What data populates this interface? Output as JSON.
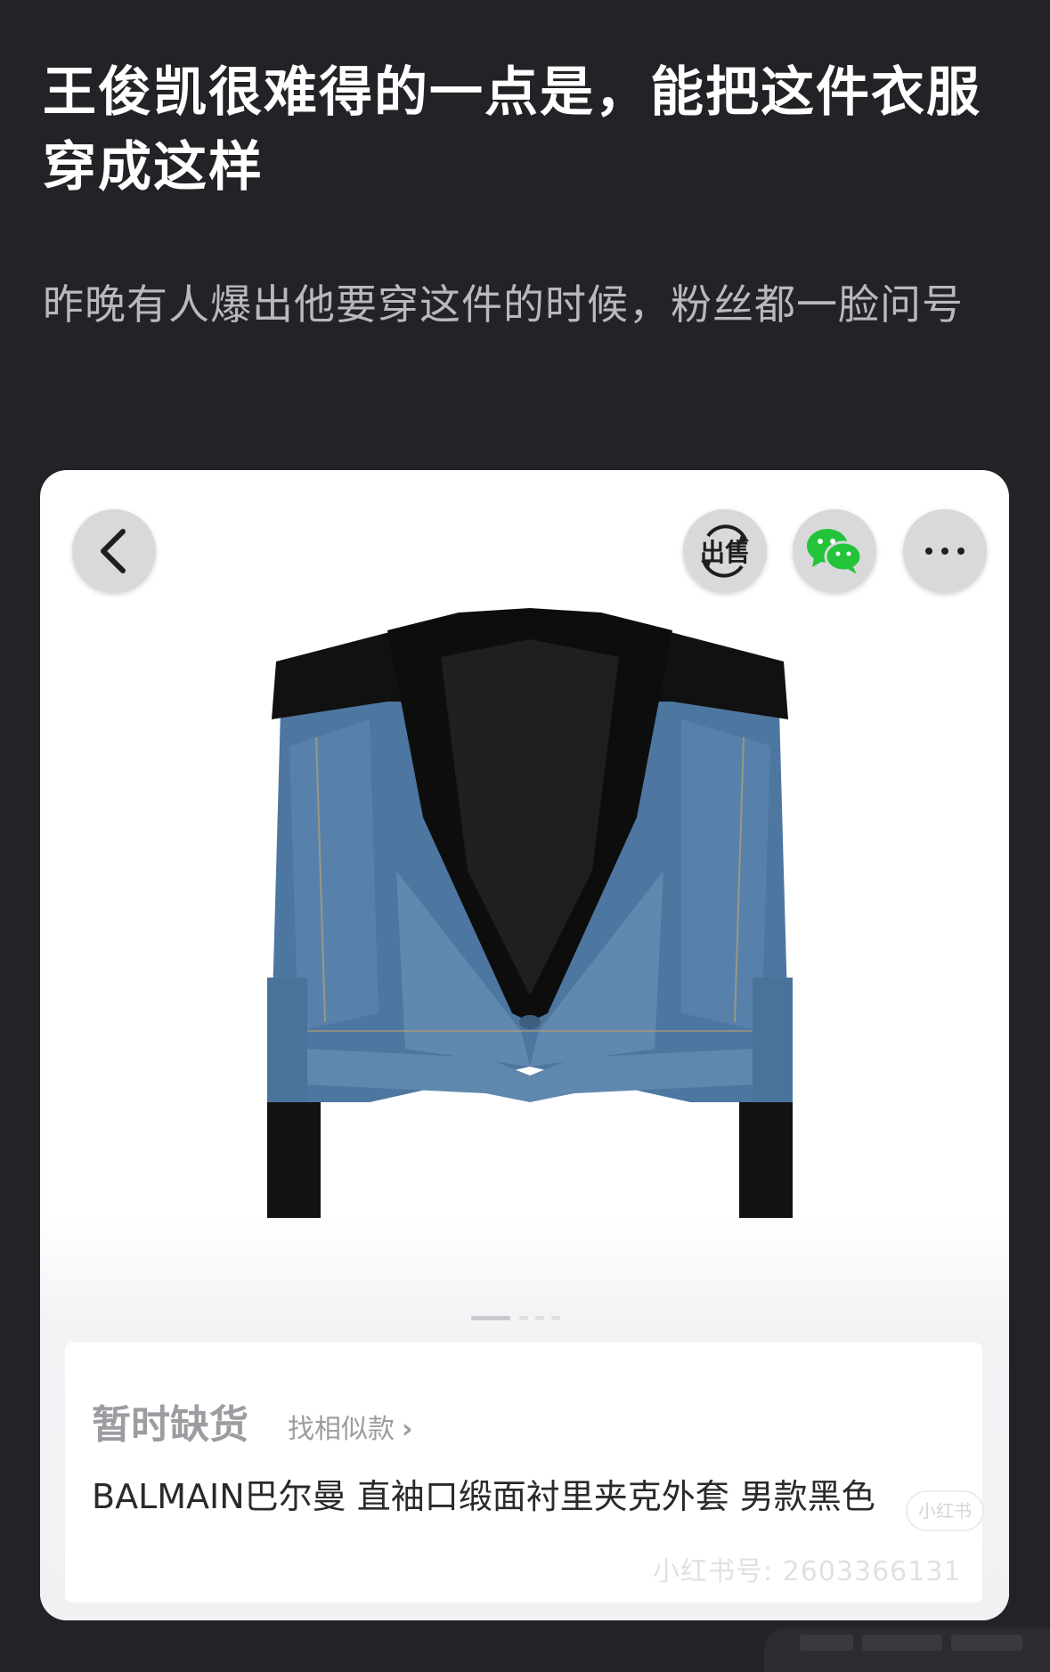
{
  "post": {
    "title": "王俊凯很难得的一点是，能把这件衣服穿成这样",
    "body": "昨晚有人爆出他要穿这件的时候，粉丝都一脸问号"
  },
  "screenshot": {
    "toolbar": {
      "back_icon": "chevron-left-icon",
      "sell_label": "出售",
      "share_icon": "wechat-icon",
      "more_icon": "more-dots-icon"
    },
    "image_pager": {
      "total": 4,
      "active_index": 0
    },
    "product": {
      "stock_status": "暂时缺货",
      "similar_link": "找相似款",
      "title": "BALMAIN巴尔曼 直袖口缎面衬里夹克外套 男款黑色"
    },
    "watermark": {
      "badge": "小红书",
      "id": "小红书号: 2603366131"
    }
  },
  "colors": {
    "page_bg": "#232227",
    "title_text": "#ffffff",
    "body_text": "#b9b8bd",
    "card_bg": "#ffffff",
    "button_bg": "#d9d9dc",
    "wechat_green": "#23c43a",
    "denim": "#4d77a0"
  }
}
